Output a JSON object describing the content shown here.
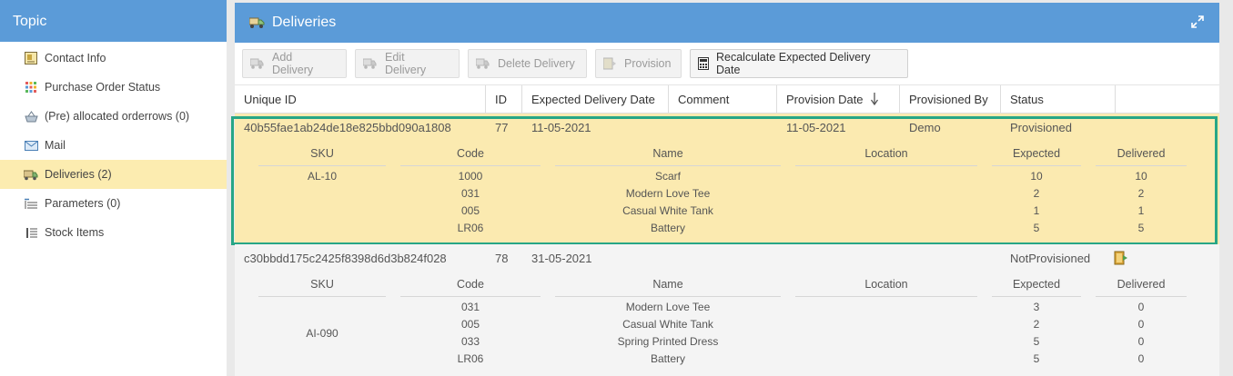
{
  "sidebar": {
    "title": "Topic",
    "items": [
      {
        "label": "Contact Info",
        "icon": "contact-card-icon"
      },
      {
        "label": "Purchase Order Status",
        "icon": "grid-dots-icon"
      },
      {
        "label": "(Pre) allocated orderrows (0)",
        "icon": "basket-icon"
      },
      {
        "label": "Mail",
        "icon": "mail-icon"
      },
      {
        "label": "Deliveries (2)",
        "icon": "truck-icon"
      },
      {
        "label": "Parameters (0)",
        "icon": "parameters-list-icon"
      },
      {
        "label": "Stock Items",
        "icon": "stock-list-icon"
      }
    ],
    "active_index": 4
  },
  "main": {
    "title": "Deliveries",
    "toolbar": {
      "add": "Add Delivery",
      "edit": "Edit Delivery",
      "delete": "Delete Delivery",
      "provision": "Provision",
      "recalc": "Recalculate Expected Delivery Date"
    },
    "columns": [
      "Unique ID",
      "ID",
      "Expected Delivery Date",
      "Comment",
      "Provision Date",
      "Provisioned By",
      "Status"
    ],
    "sub_columns": [
      "SKU",
      "Code",
      "Name",
      "Location",
      "Expected",
      "Delivered"
    ],
    "deliveries": [
      {
        "unique_id": "40b55fae1ab24de18e825bbd090a1808",
        "id": "77",
        "expected_date": "11-05-2021",
        "comment": "",
        "provision_date": "11-05-2021",
        "provisioned_by": "Demo",
        "status": "Provisioned",
        "sku": "AL-10",
        "lines": [
          {
            "code": "1000",
            "name": "Scarf",
            "location": "",
            "expected": "10",
            "delivered": "10"
          },
          {
            "code": "031",
            "name": "Modern Love Tee",
            "location": "",
            "expected": "2",
            "delivered": "2"
          },
          {
            "code": "005",
            "name": "Casual White Tank",
            "location": "",
            "expected": "1",
            "delivered": "1"
          },
          {
            "code": "LR06",
            "name": "Battery",
            "location": "",
            "expected": "5",
            "delivered": "5"
          }
        ]
      },
      {
        "unique_id": "c30bbdd175c2425f8398d6d3b824f028",
        "id": "78",
        "expected_date": "31-05-2021",
        "comment": "",
        "provision_date": "",
        "provisioned_by": "",
        "status": "NotProvisioned",
        "sku": "AI-090",
        "lines": [
          {
            "code": "031",
            "name": "Modern Love Tee",
            "location": "",
            "expected": "3",
            "delivered": "0"
          },
          {
            "code": "005",
            "name": "Casual White Tank",
            "location": "",
            "expected": "2",
            "delivered": "0"
          },
          {
            "code": "033",
            "name": "Spring Printed Dress",
            "location": "",
            "expected": "5",
            "delivered": "0"
          },
          {
            "code": "LR06",
            "name": "Battery",
            "location": "",
            "expected": "5",
            "delivered": "0"
          }
        ]
      }
    ]
  },
  "colors": {
    "header_blue": "#5b9bd8",
    "selected_row": "#fbeab0",
    "selection_border": "#27a686"
  }
}
